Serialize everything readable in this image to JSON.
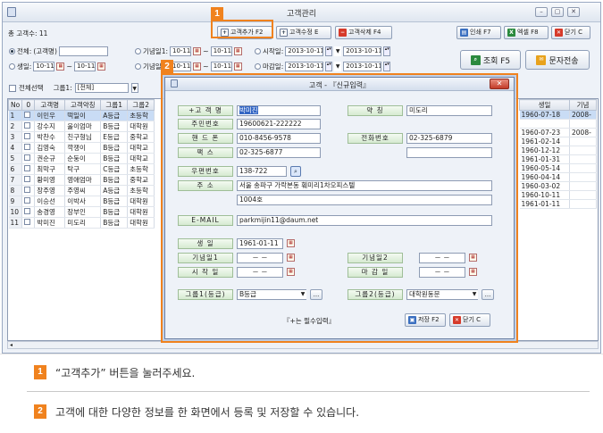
{
  "window": {
    "title": "고객관리",
    "min": "–",
    "max": "▢",
    "close": "✕"
  },
  "toolbar": {
    "count_label": "총 고객수: 11",
    "add": "고객추가 F2",
    "edit": "고객수정 E",
    "delete": "고객삭제 F4",
    "print": "인쇄 F7",
    "excel": "엑셀 F8",
    "close": "닫기 C"
  },
  "search": {
    "all_label": "전체:",
    "all_hint": "(고객명)",
    "birth_label": "생일:",
    "anniv1_label": "기념일1:",
    "anniv2_label": "기념일2:",
    "start_label": "시작일:",
    "end_label": "마감일:",
    "date_short": "10-11",
    "tilde": "~",
    "start_from": "2013-10-11",
    "start_to": "2013-10-11",
    "end_from": "2013-10-11",
    "end_to": "2013-10-11",
    "select_all": "전체선택",
    "group_label": "그룹1:",
    "group_value": "[전체]",
    "query": "조회 F5",
    "sms": "문자전송"
  },
  "grid": {
    "columns": [
      "No",
      "0",
      "고객명",
      "고객약칭",
      "그룹1",
      "그룹2"
    ],
    "rows": [
      [
        "1",
        "이민우",
        "떡일이",
        "A등급",
        "초등학"
      ],
      [
        "2",
        "강수지",
        "울이엄마",
        "B등급",
        "대학원"
      ],
      [
        "3",
        "박찬수",
        "친구형님",
        "E등급",
        "중학교"
      ],
      [
        "4",
        "김영숙",
        "깍쟁이",
        "B등급",
        "대학교"
      ],
      [
        "5",
        "권순규",
        "순둥이",
        "B등급",
        "대학교"
      ],
      [
        "6",
        "최막구",
        "탁구",
        "C등급",
        "초등학"
      ],
      [
        "7",
        "황미영",
        "영애엄마",
        "B등급",
        "중학교"
      ],
      [
        "8",
        "장주영",
        "주영씨",
        "A등급",
        "초등학"
      ],
      [
        "9",
        "이승선",
        "이박사",
        "B등급",
        "대학원"
      ],
      [
        "10",
        "송경영",
        "장부인",
        "B등급",
        "대학원"
      ],
      [
        "11",
        "박미진",
        "미도리",
        "B등급",
        "대학원"
      ]
    ],
    "right_columns": [
      "생일",
      "기념"
    ],
    "right_rows": [
      [
        "1960-07-18",
        "2008-"
      ],
      [
        "",
        ""
      ],
      [
        "1960-07-23",
        "2008-"
      ],
      [
        "1961-02-14",
        ""
      ],
      [
        "1960-12-12",
        ""
      ],
      [
        "1961-01-31",
        ""
      ],
      [
        "1960-05-14",
        ""
      ],
      [
        "1960-04-14",
        ""
      ],
      [
        "1960-03-02",
        ""
      ],
      [
        "1960-10-11",
        ""
      ],
      [
        "1961-01-11",
        ""
      ]
    ]
  },
  "dialog": {
    "title": "고객 - 『신규입력』",
    "close": "✕",
    "name_label": "+고 객 명",
    "name_value": "박미진",
    "nick_label": "약   칭",
    "nick_value": "미도리",
    "rrn_label": "주민번호",
    "rrn_value": "19600621-222222",
    "phone_label": "핸 드 폰",
    "phone_value": "010-8456-9578",
    "tel_label": "전화번호",
    "tel_value": "02-325-6879",
    "fax_label": "팩   스",
    "fax_value": "02-325-6877",
    "zip_label": "우편번호",
    "zip_value": "138-722",
    "addr_label": "주   소",
    "addr1": "서울 송파구 가락본동 훼미리1차오피스텔",
    "addr2": "1004호",
    "email_label": "E-MAIL",
    "email_value": "parkmijin11@daum.net",
    "birth_label": "생   일",
    "birth_value": "1961-01-11",
    "anniv1_label": "기념일1",
    "anniv1_value": "－  －",
    "anniv2_label": "기념일2",
    "anniv2_value": "－  －",
    "start_label": "시 작 일",
    "start_value": "－  －",
    "end_label": "마 감 일",
    "end_value": "－  －",
    "group1_label": "그룹1(등급)",
    "group1_value": "B등급",
    "group2_label": "그룹2(등급)",
    "group2_value": "대학원동문",
    "required_note": "『+는 필수입력』",
    "save": "저장 F2",
    "close_btn": "닫기 C",
    "more": "..."
  },
  "callouts": {
    "one": "1",
    "two": "2"
  },
  "captions": [
    {
      "num": "1",
      "text": "“고객추가” 버튼을 눌러주세요."
    },
    {
      "num": "2",
      "text": "고객에 대한 다양한 정보를 한 화면에서 등록 및 저장할 수 있습니다."
    }
  ],
  "colors": {
    "accent": "#f0821e",
    "label_green": "#d6ead1",
    "selected_row": "#c9dcf5"
  }
}
